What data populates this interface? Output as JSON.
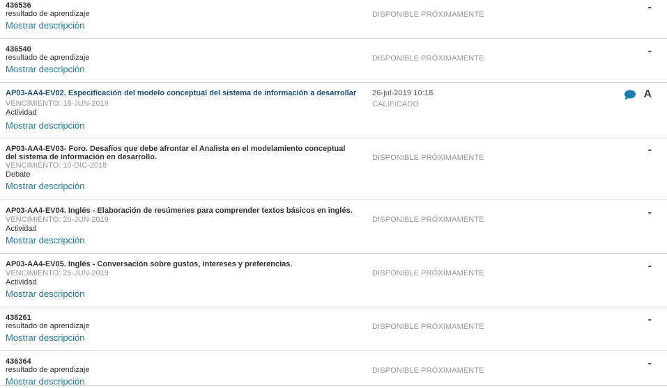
{
  "show_description_label": "Mostrar descripción",
  "accent_color": "#1a7ca8",
  "items": [
    {
      "title": "436536",
      "type": "resultado de aprendizaje",
      "status": "DISPONIBLE PRÓXIMAMENTE",
      "grade": "-"
    },
    {
      "title": "436540",
      "type": "resultado de aprendizaje",
      "status": "DISPONIBLE PRÓXIMAMENTE",
      "grade": "-"
    },
    {
      "title": "AP03-AA4-EV02. Especificación del modelo conceptual del sistema de información a desarrollar",
      "due": "VENCIMIENTO: 18-JUN-2019",
      "type": "Actividad",
      "submitted": "26-jul-2019 10:18",
      "status": "CALIFICADO",
      "grade": "A",
      "comment_icon": "speech-bubble-icon"
    },
    {
      "title": "AP03-AA4-EV03- Foro. Desafíos que debe afrontar el Analista en el modelamiento conceptual del sistema de información en desarrollo.",
      "due": "VENCIMIENTO: 10-DIC-2018",
      "type": "Debate",
      "status": "DISPONIBLE PRÓXIMAMENTE",
      "grade": "-"
    },
    {
      "title": "AP03-AA4-EV04. Inglés - Elaboración de resúmenes para comprender textos básicos en inglés.",
      "due": "VENCIMIENTO: 20-JUN-2019",
      "type": "Actividad",
      "status": "DISPONIBLE PRÓXIMAMENTE",
      "grade": "-"
    },
    {
      "title": "AP03-AA4-EV05. Inglés - Conversación sobre gustos, intereses y preferencias.",
      "due": "VENCIMIENTO: 25-JUN-2019",
      "type": "Actividad",
      "status": "DISPONIBLE PRÓXIMAMENTE",
      "grade": "-"
    },
    {
      "title": "436261",
      "type": "resultado de aprendizaje",
      "status": "DISPONIBLE PRÓXIMAMENTE",
      "grade": "-"
    },
    {
      "title": "436364",
      "type": "resultado de aprendizaje",
      "status": "DISPONIBLE PRÓXIMAMENTE",
      "grade": "-"
    }
  ]
}
